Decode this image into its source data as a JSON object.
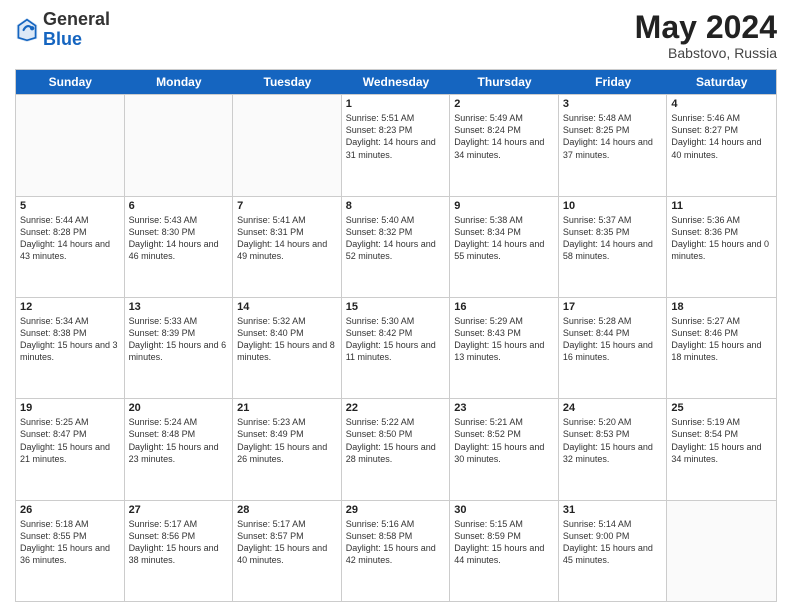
{
  "header": {
    "logo_line1": "General",
    "logo_line2": "Blue",
    "title": "May 2024",
    "location": "Babstovo, Russia"
  },
  "days_of_week": [
    "Sunday",
    "Monday",
    "Tuesday",
    "Wednesday",
    "Thursday",
    "Friday",
    "Saturday"
  ],
  "rows": [
    [
      {
        "date": "",
        "info": ""
      },
      {
        "date": "",
        "info": ""
      },
      {
        "date": "",
        "info": ""
      },
      {
        "date": "1",
        "info": "Sunrise: 5:51 AM\nSunset: 8:23 PM\nDaylight: 14 hours\nand 31 minutes."
      },
      {
        "date": "2",
        "info": "Sunrise: 5:49 AM\nSunset: 8:24 PM\nDaylight: 14 hours\nand 34 minutes."
      },
      {
        "date": "3",
        "info": "Sunrise: 5:48 AM\nSunset: 8:25 PM\nDaylight: 14 hours\nand 37 minutes."
      },
      {
        "date": "4",
        "info": "Sunrise: 5:46 AM\nSunset: 8:27 PM\nDaylight: 14 hours\nand 40 minutes."
      }
    ],
    [
      {
        "date": "5",
        "info": "Sunrise: 5:44 AM\nSunset: 8:28 PM\nDaylight: 14 hours\nand 43 minutes."
      },
      {
        "date": "6",
        "info": "Sunrise: 5:43 AM\nSunset: 8:30 PM\nDaylight: 14 hours\nand 46 minutes."
      },
      {
        "date": "7",
        "info": "Sunrise: 5:41 AM\nSunset: 8:31 PM\nDaylight: 14 hours\nand 49 minutes."
      },
      {
        "date": "8",
        "info": "Sunrise: 5:40 AM\nSunset: 8:32 PM\nDaylight: 14 hours\nand 52 minutes."
      },
      {
        "date": "9",
        "info": "Sunrise: 5:38 AM\nSunset: 8:34 PM\nDaylight: 14 hours\nand 55 minutes."
      },
      {
        "date": "10",
        "info": "Sunrise: 5:37 AM\nSunset: 8:35 PM\nDaylight: 14 hours\nand 58 minutes."
      },
      {
        "date": "11",
        "info": "Sunrise: 5:36 AM\nSunset: 8:36 PM\nDaylight: 15 hours\nand 0 minutes."
      }
    ],
    [
      {
        "date": "12",
        "info": "Sunrise: 5:34 AM\nSunset: 8:38 PM\nDaylight: 15 hours\nand 3 minutes."
      },
      {
        "date": "13",
        "info": "Sunrise: 5:33 AM\nSunset: 8:39 PM\nDaylight: 15 hours\nand 6 minutes."
      },
      {
        "date": "14",
        "info": "Sunrise: 5:32 AM\nSunset: 8:40 PM\nDaylight: 15 hours\nand 8 minutes."
      },
      {
        "date": "15",
        "info": "Sunrise: 5:30 AM\nSunset: 8:42 PM\nDaylight: 15 hours\nand 11 minutes."
      },
      {
        "date": "16",
        "info": "Sunrise: 5:29 AM\nSunset: 8:43 PM\nDaylight: 15 hours\nand 13 minutes."
      },
      {
        "date": "17",
        "info": "Sunrise: 5:28 AM\nSunset: 8:44 PM\nDaylight: 15 hours\nand 16 minutes."
      },
      {
        "date": "18",
        "info": "Sunrise: 5:27 AM\nSunset: 8:46 PM\nDaylight: 15 hours\nand 18 minutes."
      }
    ],
    [
      {
        "date": "19",
        "info": "Sunrise: 5:25 AM\nSunset: 8:47 PM\nDaylight: 15 hours\nand 21 minutes."
      },
      {
        "date": "20",
        "info": "Sunrise: 5:24 AM\nSunset: 8:48 PM\nDaylight: 15 hours\nand 23 minutes."
      },
      {
        "date": "21",
        "info": "Sunrise: 5:23 AM\nSunset: 8:49 PM\nDaylight: 15 hours\nand 26 minutes."
      },
      {
        "date": "22",
        "info": "Sunrise: 5:22 AM\nSunset: 8:50 PM\nDaylight: 15 hours\nand 28 minutes."
      },
      {
        "date": "23",
        "info": "Sunrise: 5:21 AM\nSunset: 8:52 PM\nDaylight: 15 hours\nand 30 minutes."
      },
      {
        "date": "24",
        "info": "Sunrise: 5:20 AM\nSunset: 8:53 PM\nDaylight: 15 hours\nand 32 minutes."
      },
      {
        "date": "25",
        "info": "Sunrise: 5:19 AM\nSunset: 8:54 PM\nDaylight: 15 hours\nand 34 minutes."
      }
    ],
    [
      {
        "date": "26",
        "info": "Sunrise: 5:18 AM\nSunset: 8:55 PM\nDaylight: 15 hours\nand 36 minutes."
      },
      {
        "date": "27",
        "info": "Sunrise: 5:17 AM\nSunset: 8:56 PM\nDaylight: 15 hours\nand 38 minutes."
      },
      {
        "date": "28",
        "info": "Sunrise: 5:17 AM\nSunset: 8:57 PM\nDaylight: 15 hours\nand 40 minutes."
      },
      {
        "date": "29",
        "info": "Sunrise: 5:16 AM\nSunset: 8:58 PM\nDaylight: 15 hours\nand 42 minutes."
      },
      {
        "date": "30",
        "info": "Sunrise: 5:15 AM\nSunset: 8:59 PM\nDaylight: 15 hours\nand 44 minutes."
      },
      {
        "date": "31",
        "info": "Sunrise: 5:14 AM\nSunset: 9:00 PM\nDaylight: 15 hours\nand 45 minutes."
      },
      {
        "date": "",
        "info": ""
      }
    ]
  ]
}
